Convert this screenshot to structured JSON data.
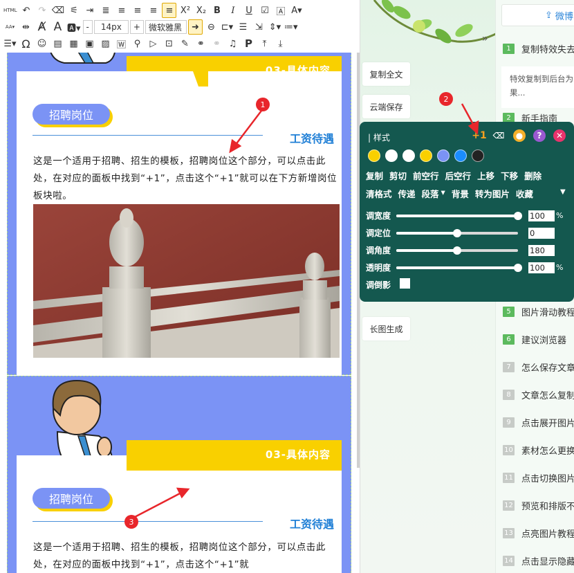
{
  "toolbar": {
    "html_label": "HTML",
    "font_size": "14px",
    "font_family": "微软雅黑",
    "superscript": "X²",
    "subscript": "X₂",
    "bold": "B",
    "italic": "I",
    "underline": "U",
    "font_a": "A",
    "minus": "-",
    "plus": "+",
    "omega": "Ω",
    "para": "P"
  },
  "editor": {
    "blocks": [
      {
        "banner": "03-具体内容",
        "pill": "招聘岗位",
        "salary": "工资待遇",
        "body": "这是一个适用于招聘、招生的模板，招聘岗位这个部分，可以点击此处，在对应的面板中找到“+1”，点击这个“+1”就可以在下方新增岗位板块啦。"
      },
      {
        "banner": "03-具体内容",
        "pill": "招聘岗位",
        "salary": "工资待遇",
        "body": "这是一个适用于招聘、招生的模板，招聘岗位这个部分，可以点击此处，在对应的面板中找到“+1”，点击这个“+1”就"
      }
    ]
  },
  "sidebar": {
    "buttons": [
      "复制全文",
      "云端保存",
      "长图生成"
    ]
  },
  "right_panel": {
    "wechat_label": "微博",
    "description": "特效复制到后台为果...",
    "items": [
      {
        "n": "1",
        "label": "复制特效失去",
        "style": "green"
      },
      {
        "n": "2",
        "label": "新手指南",
        "style": "green"
      },
      {
        "n": "5",
        "label": "图片滑动教程",
        "style": "green"
      },
      {
        "n": "6",
        "label": "建议浏览器",
        "style": "green"
      },
      {
        "n": "7",
        "label": "怎么保存文章",
        "style": "gray"
      },
      {
        "n": "8",
        "label": "文章怎么复制",
        "style": "gray"
      },
      {
        "n": "9",
        "label": "点击展开图片",
        "style": "gray"
      },
      {
        "n": "10",
        "label": "素材怎么更换",
        "style": "gray"
      },
      {
        "n": "11",
        "label": "点击切换图片",
        "style": "gray"
      },
      {
        "n": "12",
        "label": "预览和排版不",
        "style": "gray"
      },
      {
        "n": "13",
        "label": "点亮图片教程",
        "style": "gray"
      },
      {
        "n": "14",
        "label": "点击显示隐藏",
        "style": "gray"
      }
    ]
  },
  "popup": {
    "title": "| 样式",
    "plus_one": "+1",
    "swatches": [
      "#f9d000",
      "#ffffff",
      "#ffffff",
      "#f9d000",
      "#7b93f5",
      "#1a8cff",
      "#222222"
    ],
    "row1": [
      "复制",
      "剪切",
      "前空行",
      "后空行",
      "上移",
      "下移",
      "删除"
    ],
    "row2": [
      "清格式",
      "传递",
      "段落",
      "背景",
      "转为图片",
      "收藏"
    ],
    "sliders": [
      {
        "label": "调宽度",
        "value": "100",
        "unit": "%",
        "pos": 1.0
      },
      {
        "label": "调定位",
        "value": "0",
        "unit": "",
        "pos": 0.5
      },
      {
        "label": "调角度",
        "value": "180",
        "unit": "",
        "pos": 0.5
      },
      {
        "label": "透明度",
        "value": "100",
        "unit": "%",
        "pos": 1.0
      }
    ],
    "shadow_label": "调倒影"
  },
  "annotations": [
    "1",
    "2",
    "3"
  ]
}
